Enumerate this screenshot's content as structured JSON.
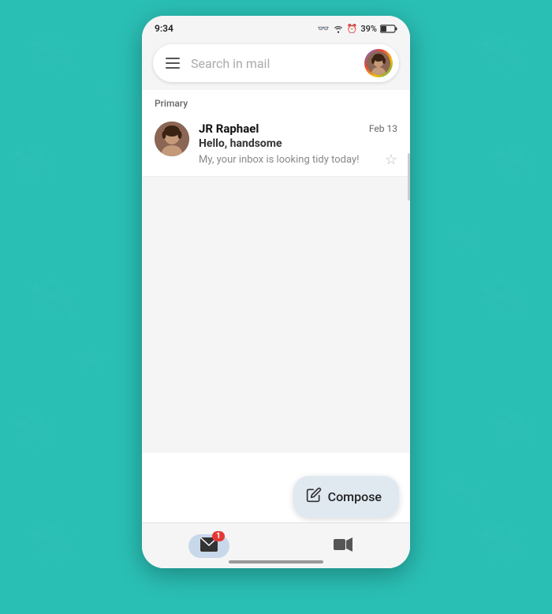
{
  "statusBar": {
    "time": "9:34",
    "battery": "39%"
  },
  "searchBar": {
    "placeholder": "Search in mail",
    "hamburgerLabel": "Menu"
  },
  "sections": [
    {
      "label": "Primary",
      "emails": [
        {
          "sender": "JR Raphael",
          "subject": "Hello, handsome",
          "preview": "My, your inbox is looking tidy today!",
          "date": "Feb 13",
          "starred": false
        }
      ]
    }
  ],
  "fab": {
    "label": "Compose",
    "icon": "✏"
  },
  "bottomNav": {
    "items": [
      {
        "label": "Mail",
        "icon": "✉",
        "active": true,
        "badge": "1"
      },
      {
        "label": "Meet",
        "icon": "📹",
        "active": false,
        "badge": ""
      }
    ]
  },
  "colors": {
    "teal": "#2abfb5",
    "white": "#ffffff",
    "primary": "#1a73e8",
    "badgeRed": "#e53935"
  }
}
